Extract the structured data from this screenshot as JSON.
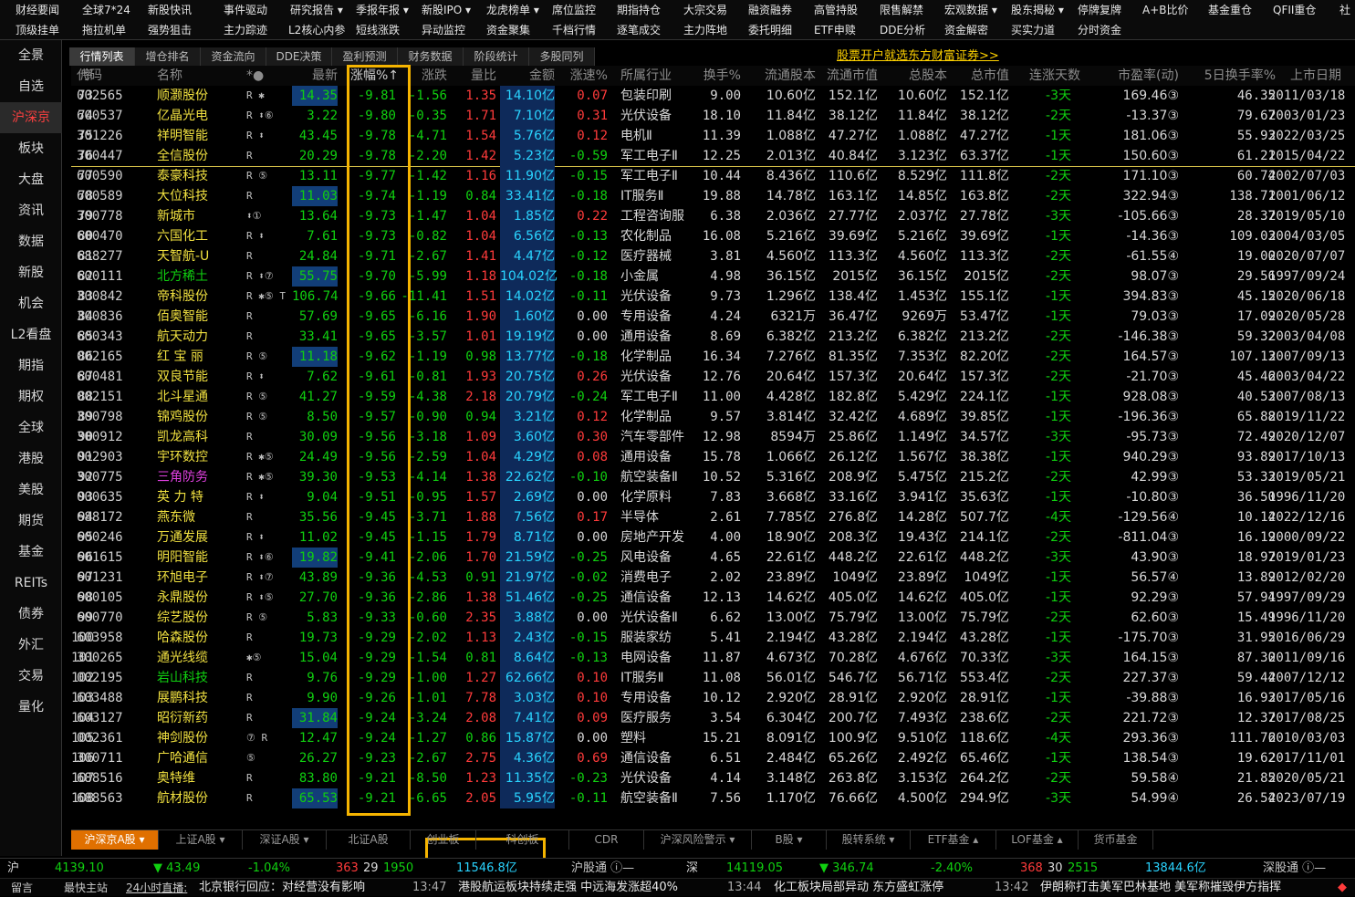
{
  "menu_row1": [
    "财经要闻",
    "全球7*24",
    "新股快讯",
    "事件驱动",
    "研究报告 ▾",
    "季报年报 ▾",
    "新股IPO ▾",
    "龙虎榜单 ▾",
    "席位监控",
    "期指持仓",
    "大宗交易",
    "融资融券",
    "高管持股",
    "限售解禁",
    "宏观数据 ▾",
    "股东揭秘 ▾",
    "停牌复牌",
    "A+B比价",
    "基金重仓",
    "QFII重仓",
    "社"
  ],
  "menu_row2": [
    "顶级挂单",
    "拖拉机单",
    "强势狙击",
    "主力踪迹",
    "L2核心内参",
    "短线涨跌",
    "异动监控",
    "资金聚集",
    "千档行情",
    "逐笔成交",
    "主力阵地",
    "委托明细",
    "ETF申赎",
    "DDE分析",
    "资金解密",
    "买实力道",
    "分时资金"
  ],
  "sidebar": [
    "全景",
    "自选",
    "沪深京",
    "板块",
    "大盘",
    "资讯",
    "数据",
    "新股",
    "机会",
    "L2看盘",
    "期指",
    "期权",
    "全球",
    "港股",
    "美股",
    "期货",
    "基金",
    "REITs",
    "债券",
    "外汇",
    "交易",
    "量化"
  ],
  "sidebar_active": 2,
  "tabs": [
    "行情列表",
    "增仓排名",
    "资金流向",
    "DDE决策",
    "盈利预测",
    "财务数据",
    "阶段统计",
    "多股同列"
  ],
  "promo": "股票开户就选东方财富证券>>",
  "headers": {
    "seq": "序",
    "code": "代码",
    "name": "名称",
    "flags": "*●",
    "price": "最新",
    "pct": "涨幅%↑",
    "chg": "涨跌",
    "vr": "量比",
    "amt": "金额",
    "speed": "涨速%",
    "ind": "所属行业",
    "turn": "换手%",
    "fshares": "流通股本",
    "fcap": "流通市值",
    "tshares": "总股本",
    "tcap": "总市值",
    "days": "连涨天数",
    "pe": "市盈率(动)",
    "turn5": "5日换手率%",
    "date": "上市日期"
  },
  "rows": [
    [
      "73",
      "002565",
      "顺灏股份",
      "R ✱",
      "14.35",
      "-9.81",
      "-1.56",
      "1.35",
      "14.10亿",
      "0.07",
      "包装印刷",
      "9.00",
      "10.60亿",
      "152.1亿",
      "10.60亿",
      "152.1亿",
      "-3天",
      "169.46③",
      "46.35",
      "2011/03/18"
    ],
    [
      "74",
      "600537",
      "亿晶光电",
      "R ⬍⑥",
      "3.22",
      "-9.80",
      "-0.35",
      "1.71",
      "7.10亿",
      "0.31",
      "光伏设备",
      "18.10",
      "11.84亿",
      "38.12亿",
      "11.84亿",
      "38.12亿",
      "-2天",
      "-13.37③",
      "79.67",
      "2003/01/23"
    ],
    [
      "75",
      "301226",
      "祥明智能",
      "R ⬍",
      "43.45",
      "-9.78",
      "-4.71",
      "1.54",
      "5.76亿",
      "0.12",
      "电机Ⅱ",
      "11.39",
      "1.088亿",
      "47.27亿",
      "1.088亿",
      "47.27亿",
      "-1天",
      "181.06③",
      "55.93",
      "2022/03/25"
    ],
    [
      "76",
      "300447",
      "全信股份",
      "R",
      "20.29",
      "-9.78",
      "-2.20",
      "1.42",
      "5.23亿",
      "-0.59",
      "军工电子Ⅱ",
      "12.25",
      "2.013亿",
      "40.84亿",
      "3.123亿",
      "63.37亿",
      "-1天",
      "150.60③",
      "61.21",
      "2015/04/22"
    ],
    [
      "77",
      "600590",
      "泰豪科技",
      "R ⑤",
      "13.11",
      "-9.77",
      "-1.42",
      "1.16",
      "11.90亿",
      "-0.15",
      "军工电子Ⅱ",
      "10.44",
      "8.436亿",
      "110.6亿",
      "8.529亿",
      "111.8亿",
      "-2天",
      "171.10③",
      "60.74",
      "2002/07/03"
    ],
    [
      "78",
      "600589",
      "大位科技",
      "R",
      "11.03",
      "-9.74",
      "-1.19",
      "0.84",
      "33.41亿",
      "-0.18",
      "IT服务Ⅱ",
      "19.88",
      "14.78亿",
      "163.1亿",
      "14.85亿",
      "163.8亿",
      "-2天",
      "322.94③",
      "138.71",
      "2001/06/12"
    ],
    [
      "79",
      "300778",
      "新城市",
      "⬍①",
      "13.64",
      "-9.73",
      "-1.47",
      "1.04",
      "1.85亿",
      "0.22",
      "工程咨询服",
      "6.38",
      "2.036亿",
      "27.77亿",
      "2.037亿",
      "27.78亿",
      "-3天",
      "-105.66③",
      "28.37",
      "2019/05/10"
    ],
    [
      "80",
      "600470",
      "六国化工",
      "R ⬍",
      "7.61",
      "-9.73",
      "-0.82",
      "1.04",
      "6.56亿",
      "-0.13",
      "农化制品",
      "16.08",
      "5.216亿",
      "39.69亿",
      "5.216亿",
      "39.69亿",
      "-1天",
      "-14.36③",
      "109.03",
      "2004/03/05"
    ],
    [
      "81",
      "688277",
      "天智航-U",
      "R",
      "24.84",
      "-9.71",
      "-2.67",
      "1.41",
      "4.47亿",
      "-0.12",
      "医疗器械",
      "3.81",
      "4.560亿",
      "113.3亿",
      "4.560亿",
      "113.3亿",
      "-2天",
      "-61.55④",
      "19.00",
      "2020/07/07"
    ],
    [
      "82",
      "600111",
      "北方稀土",
      "R ⬍⑦",
      "55.75",
      "-9.70",
      "-5.99",
      "1.18",
      "104.02亿",
      "-0.18",
      "小金属",
      "4.98",
      "36.15亿",
      "2015亿",
      "36.15亿",
      "2015亿",
      "-2天",
      "98.07③",
      "29.56",
      "1997/09/24"
    ],
    [
      "83",
      "300842",
      "帝科股份",
      "R ✱⑤ T",
      "106.74",
      "-9.66",
      "-11.41",
      "1.51",
      "14.02亿",
      "-0.11",
      "光伏设备",
      "9.73",
      "1.296亿",
      "138.4亿",
      "1.453亿",
      "155.1亿",
      "-1天",
      "394.83③",
      "45.15",
      "2020/06/18"
    ],
    [
      "84",
      "300836",
      "佰奥智能",
      "R",
      "57.69",
      "-9.65",
      "-6.16",
      "1.90",
      "1.60亿",
      "0.00",
      "专用设备",
      "4.24",
      "6321万",
      "36.47亿",
      "9269万",
      "53.47亿",
      "-1天",
      "79.03③",
      "17.09",
      "2020/05/28"
    ],
    [
      "85",
      "600343",
      "航天动力",
      "R",
      "33.41",
      "-9.65",
      "-3.57",
      "1.01",
      "19.19亿",
      "0.00",
      "通用设备",
      "8.69",
      "6.382亿",
      "213.2亿",
      "6.382亿",
      "213.2亿",
      "-2天",
      "-146.38③",
      "59.32",
      "2003/04/08"
    ],
    [
      "86",
      "002165",
      "红 宝 丽",
      "R ⑤",
      "11.18",
      "-9.62",
      "-1.19",
      "0.98",
      "13.77亿",
      "-0.18",
      "化学制品",
      "16.34",
      "7.276亿",
      "81.35亿",
      "7.353亿",
      "82.20亿",
      "-2天",
      "164.57③",
      "107.13",
      "2007/09/13"
    ],
    [
      "87",
      "600481",
      "双良节能",
      "R ⬍",
      "7.62",
      "-9.61",
      "-0.81",
      "1.93",
      "20.75亿",
      "0.26",
      "光伏设备",
      "12.76",
      "20.64亿",
      "157.3亿",
      "20.64亿",
      "157.3亿",
      "-2天",
      "-21.70③",
      "45.46",
      "2003/04/22"
    ],
    [
      "88",
      "002151",
      "北斗星通",
      "R ⑤",
      "41.27",
      "-9.59",
      "-4.38",
      "2.18",
      "20.79亿",
      "-0.24",
      "军工电子Ⅱ",
      "11.00",
      "4.428亿",
      "182.8亿",
      "5.429亿",
      "224.1亿",
      "-1天",
      "928.08③",
      "40.53",
      "2007/08/13"
    ],
    [
      "89",
      "300798",
      "锦鸡股份",
      "R ⑤",
      "8.50",
      "-9.57",
      "-0.90",
      "0.94",
      "3.21亿",
      "0.12",
      "化学制品",
      "9.57",
      "3.814亿",
      "32.42亿",
      "4.689亿",
      "39.85亿",
      "-1天",
      "-196.36③",
      "65.88",
      "2019/11/22"
    ],
    [
      "90",
      "300912",
      "凯龙高科",
      "R",
      "30.09",
      "-9.56",
      "-3.18",
      "1.09",
      "3.60亿",
      "0.30",
      "汽车零部件",
      "12.98",
      "8594万",
      "25.86亿",
      "1.149亿",
      "34.57亿",
      "-3天",
      "-95.73③",
      "72.49",
      "2020/12/07"
    ],
    [
      "91",
      "002903",
      "宇环数控",
      "R ✱⑤",
      "24.49",
      "-9.56",
      "-2.59",
      "1.04",
      "4.29亿",
      "0.08",
      "通用设备",
      "15.78",
      "1.066亿",
      "26.12亿",
      "1.567亿",
      "38.38亿",
      "-1天",
      "940.29③",
      "93.89",
      "2017/10/13"
    ],
    [
      "92",
      "300775",
      "三角防务",
      "R ✱⑤",
      "39.30",
      "-9.53",
      "-4.14",
      "1.38",
      "22.62亿",
      "-0.10",
      "航空装备Ⅱ",
      "10.52",
      "5.316亿",
      "208.9亿",
      "5.475亿",
      "215.2亿",
      "-2天",
      "42.99③",
      "53.33",
      "2019/05/21"
    ],
    [
      "93",
      "000635",
      "英 力 特",
      "R ⬍",
      "9.04",
      "-9.51",
      "-0.95",
      "1.57",
      "2.69亿",
      "0.00",
      "化学原料",
      "7.83",
      "3.668亿",
      "33.16亿",
      "3.941亿",
      "35.63亿",
      "-1天",
      "-10.80③",
      "36.50",
      "1996/11/20"
    ],
    [
      "94",
      "688172",
      "燕东微",
      "R",
      "35.56",
      "-9.45",
      "-3.71",
      "1.88",
      "7.56亿",
      "0.17",
      "半导体",
      "2.61",
      "7.785亿",
      "276.8亿",
      "14.28亿",
      "507.7亿",
      "-4天",
      "-129.56④",
      "10.14",
      "2022/12/16"
    ],
    [
      "95",
      "600246",
      "万通发展",
      "R ⬍",
      "11.02",
      "-9.45",
      "-1.15",
      "1.79",
      "8.71亿",
      "0.00",
      "房地产开发",
      "4.00",
      "18.90亿",
      "208.3亿",
      "19.43亿",
      "214.1亿",
      "-2天",
      "-811.04③",
      "16.19",
      "2000/09/22"
    ],
    [
      "96",
      "601615",
      "明阳智能",
      "R ⬍⑥",
      "19.82",
      "-9.41",
      "-2.06",
      "1.70",
      "21.59亿",
      "-0.25",
      "风电设备",
      "4.65",
      "22.61亿",
      "448.2亿",
      "22.61亿",
      "448.2亿",
      "-3天",
      "43.90③",
      "18.97",
      "2019/01/23"
    ],
    [
      "97",
      "601231",
      "环旭电子",
      "R ⬍⑦",
      "43.89",
      "-9.36",
      "-4.53",
      "0.91",
      "21.97亿",
      "-0.02",
      "消费电子",
      "2.02",
      "23.89亿",
      "1049亿",
      "23.89亿",
      "1049亿",
      "-1天",
      "56.57④",
      "13.89",
      "2012/02/20"
    ],
    [
      "98",
      "600105",
      "永鼎股份",
      "R ⬍⑤",
      "27.70",
      "-9.36",
      "-2.86",
      "1.38",
      "51.46亿",
      "-0.25",
      "通信设备",
      "12.13",
      "14.62亿",
      "405.0亿",
      "14.62亿",
      "405.0亿",
      "-1天",
      "92.29③",
      "57.94",
      "1997/09/29"
    ],
    [
      "99",
      "600770",
      "综艺股份",
      "R ⑤",
      "5.83",
      "-9.33",
      "-0.60",
      "2.35",
      "3.88亿",
      "0.00",
      "光伏设备Ⅱ",
      "6.62",
      "13.00亿",
      "75.79亿",
      "13.00亿",
      "75.79亿",
      "-2天",
      "62.60③",
      "15.49",
      "1996/11/20"
    ],
    [
      "100",
      "603958",
      "哈森股份",
      "R",
      "19.73",
      "-9.29",
      "-2.02",
      "1.13",
      "2.43亿",
      "-0.15",
      "服装家纺",
      "5.41",
      "2.194亿",
      "43.28亿",
      "2.194亿",
      "43.28亿",
      "-1天",
      "-175.70③",
      "31.95",
      "2016/06/29"
    ],
    [
      "101",
      "300265",
      "通光线缆",
      "✱⑤",
      "15.04",
      "-9.29",
      "-1.54",
      "0.81",
      "8.64亿",
      "-0.13",
      "电网设备",
      "11.87",
      "4.673亿",
      "70.28亿",
      "4.676亿",
      "70.33亿",
      "-3天",
      "164.15③",
      "87.30",
      "2011/09/16"
    ],
    [
      "102",
      "002195",
      "岩山科技",
      "R",
      "9.76",
      "-9.29",
      "-1.00",
      "1.27",
      "62.66亿",
      "0.10",
      "IT服务Ⅱ",
      "11.08",
      "56.01亿",
      "546.7亿",
      "56.71亿",
      "553.4亿",
      "-2天",
      "227.37③",
      "59.44",
      "2007/12/12"
    ],
    [
      "103",
      "603488",
      "展鹏科技",
      "R",
      "9.90",
      "-9.26",
      "-1.01",
      "7.78",
      "3.03亿",
      "0.10",
      "专用设备",
      "10.12",
      "2.920亿",
      "28.91亿",
      "2.920亿",
      "28.91亿",
      "-1天",
      "-39.88③",
      "16.93",
      "2017/05/16"
    ],
    [
      "104",
      "603127",
      "昭衍新药",
      "R",
      "31.84",
      "-9.24",
      "-3.24",
      "2.08",
      "7.41亿",
      "0.09",
      "医疗服务",
      "3.54",
      "6.304亿",
      "200.7亿",
      "7.493亿",
      "238.6亿",
      "-2天",
      "221.72③",
      "12.37",
      "2017/08/25"
    ],
    [
      "105",
      "002361",
      "神剑股份",
      "⑦ R",
      "12.47",
      "-9.24",
      "-1.27",
      "0.86",
      "15.87亿",
      "0.00",
      "塑料",
      "15.21",
      "8.091亿",
      "100.9亿",
      "9.510亿",
      "118.6亿",
      "-4天",
      "293.36③",
      "111.76",
      "2010/03/03"
    ],
    [
      "106",
      "300711",
      "广哈通信",
      "⑤",
      "26.27",
      "-9.23",
      "-2.67",
      "2.75",
      "4.36亿",
      "0.69",
      "通信设备",
      "6.51",
      "2.484亿",
      "65.26亿",
      "2.492亿",
      "65.46亿",
      "-1天",
      "138.54③",
      "19.62",
      "2017/11/01"
    ],
    [
      "107",
      "688516",
      "奥特维",
      "R",
      "83.80",
      "-9.21",
      "-8.50",
      "1.23",
      "11.35亿",
      "-0.23",
      "光伏设备",
      "4.14",
      "3.148亿",
      "263.8亿",
      "3.153亿",
      "264.2亿",
      "-2天",
      "59.58④",
      "21.85",
      "2020/05/21"
    ],
    [
      "108",
      "688563",
      "航材股份",
      "R",
      "65.53",
      "-9.21",
      "-6.65",
      "2.05",
      "5.95亿",
      "-0.11",
      "航空装备Ⅱ",
      "7.56",
      "1.170亿",
      "76.66亿",
      "4.500亿",
      "294.9亿",
      "-3天",
      "54.99④",
      "26.54",
      "2023/07/19"
    ]
  ],
  "colors": {
    "down": "#10d010",
    "up": "#ff3b3b",
    "cyan": "#2ad4ff",
    "yellow": "#f0e040",
    "magenta": "#e040e0",
    "highlight": "#f5b400",
    "orange_tab": "#e07000"
  },
  "bottom_tabs": [
    "沪深京A股 ▾",
    "上证A股 ▾",
    "深证A股 ▾",
    "北证A股",
    "创业板",
    "科创板",
    "CDR",
    "沪深风险警示 ▾",
    "B股 ▾",
    "股转系统 ▾",
    "ETF基金 ▴",
    "LOF基金 ▴",
    "货币基金"
  ],
  "status": {
    "sh_label": "沪",
    "sh_index": "4139.10",
    "sh_chg": "▼ 43.49",
    "sh_pct": "-1.04%",
    "sh_up": "363",
    "sh_flat": "29",
    "sh_down": "1950",
    "sh_amt": "11546.8亿",
    "sh_connect": "沪股通 ⓘ—",
    "sz_label": "深",
    "sz_index": "14119.05",
    "sz_chg": "▼ 346.74",
    "sz_pct": "-2.40%",
    "sz_up": "368",
    "sz_flat": "30",
    "sz_down": "2515",
    "sz_amt": "13844.6亿",
    "sz_connect": "深股通 ⓘ—"
  },
  "ticker": {
    "left1": "留言",
    "left2": "最快主站",
    "left3": "24小时直播:",
    "news1": "北京银行回应：对经营没有影响",
    "time1": "13:47",
    "news2": "港股航运板块持续走强 中远海发涨超40%",
    "time2": "13:44",
    "news3": "化工板块局部异动 东方盛虹涨停",
    "time3": "13:42",
    "news4": "伊朗称打击美军巴林基地 美军称摧毁伊方指挥",
    "end": "◆"
  }
}
